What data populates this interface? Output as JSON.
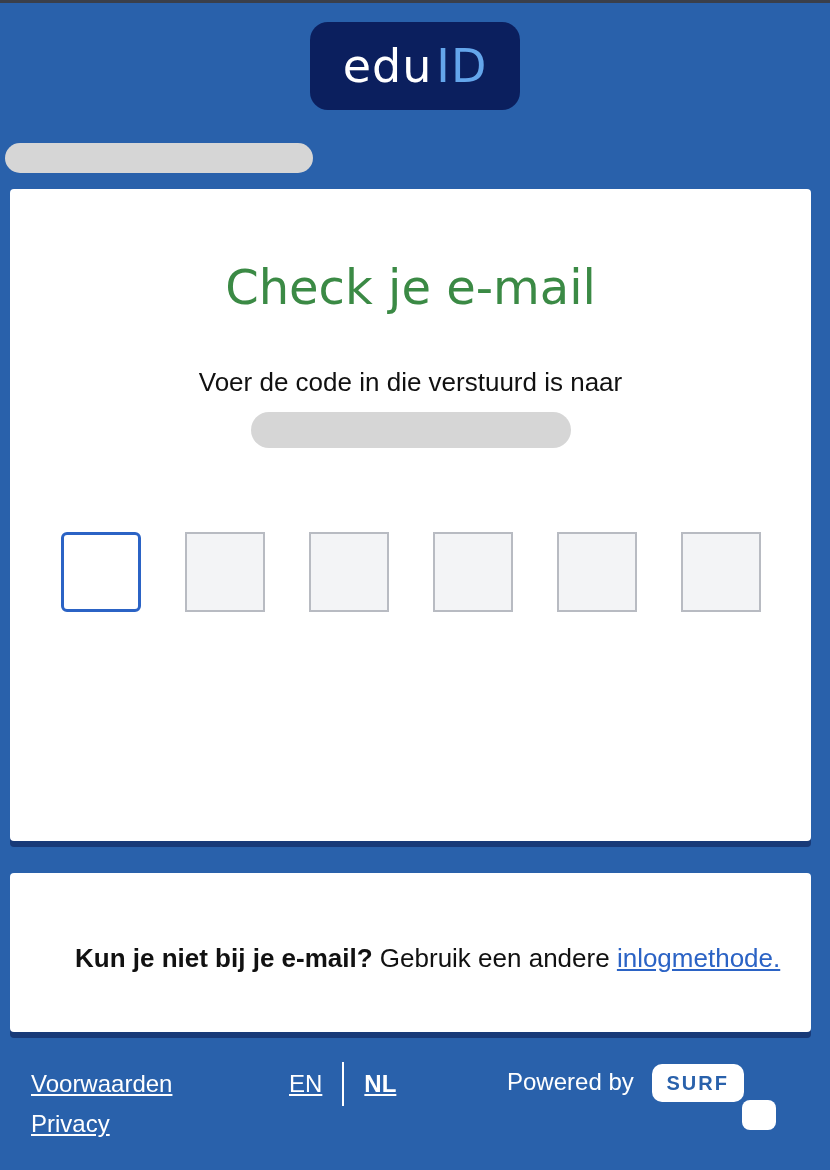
{
  "logo": {
    "part_1": "edu",
    "part_2": "ID"
  },
  "card": {
    "title": "Check je e-mail",
    "instruction": "Voer de code in die verstuurd is naar",
    "code_inputs": [
      {
        "focused": true
      },
      {
        "focused": false
      },
      {
        "focused": false
      },
      {
        "focused": false
      },
      {
        "focused": false
      },
      {
        "focused": false
      }
    ]
  },
  "help": {
    "question": "Kun je niet bij je e-mail?",
    "text": "Gebruik een andere",
    "link": "inlogmethode."
  },
  "footer": {
    "links": [
      "Voorwaarden",
      "Privacy"
    ],
    "languages": [
      {
        "label": "EN",
        "selected": false
      },
      {
        "label": "NL",
        "selected": true
      }
    ],
    "powered_by": "Powered by",
    "brand": "SURF"
  }
}
